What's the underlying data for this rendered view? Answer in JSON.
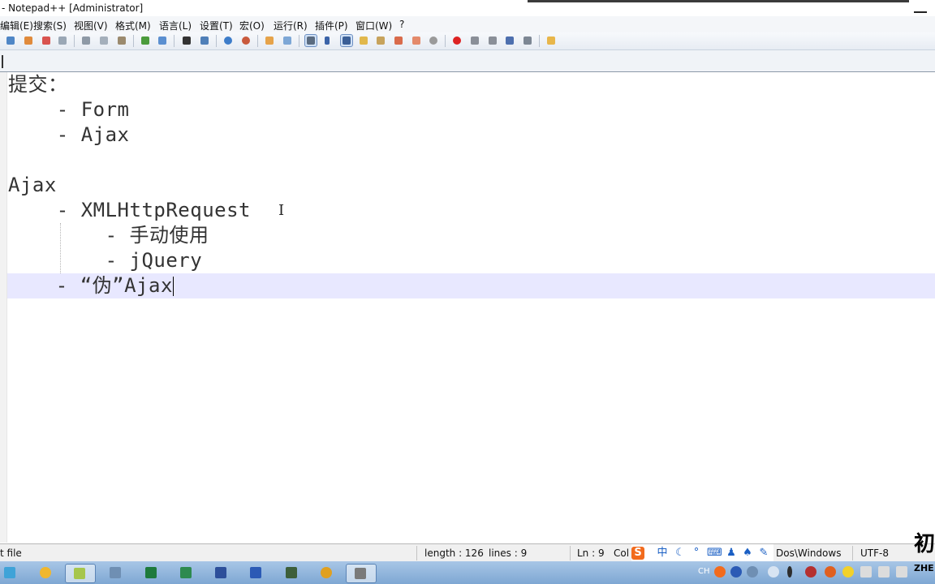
{
  "window": {
    "title": "- Notepad++ [Administrator]"
  },
  "menu": [
    {
      "label": "编辑(E)"
    },
    {
      "label": "搜索(S)"
    },
    {
      "label": "视图(V)"
    },
    {
      "label": "格式(M)"
    },
    {
      "label": "语言(L)"
    },
    {
      "label": "设置(T)"
    },
    {
      "label": "宏(O)"
    },
    {
      "label": "运行(R)"
    },
    {
      "label": "插件(P)"
    },
    {
      "label": "窗口(W)"
    },
    {
      "label": "?"
    }
  ],
  "toolbar_icons": [
    "new-file-icon",
    "open-file-icon",
    "save-icon",
    "save-all-icon",
    "close-icon",
    "print-icon",
    "cut-icon",
    "copy-icon",
    "paste-icon",
    "undo-icon",
    "redo-icon",
    "find-icon",
    "replace-icon",
    "zoom-in-icon",
    "zoom-out-icon",
    "sync-vertical-icon",
    "sync-horizontal-icon",
    "word-wrap-icon",
    "show-all-chars-icon",
    "indent-guide-icon",
    "user-defined-language-icon",
    "doc-map-icon",
    "function-list-icon",
    "folder-as-workspace-icon",
    "monitoring-icon",
    "record-macro-icon",
    "stop-macro-icon",
    "play-macro-icon",
    "run-macro-multiple-icon",
    "save-macro-icon",
    "launch-in-browser-icon"
  ],
  "editor": {
    "lines": [
      "提交：",
      "    - Form",
      "    - Ajax",
      "",
      "Ajax",
      "    - XMLHttpRequest",
      "        - 手动使用",
      "        - jQuery",
      "    - “伪”Ajax"
    ]
  },
  "status": {
    "file_type": "t file",
    "length": "length : 126",
    "lines": "lines : 9",
    "ln": "Ln : 9",
    "col": "Col :",
    "eol": "Dos\\Windows",
    "encoding": "UTF-8"
  },
  "ime": {
    "lang": "中"
  },
  "taskbar": {
    "tray_text": "CH",
    "logo_text": "初",
    "logo_sub": "ZHE"
  },
  "colors": {
    "current_line": "#e8e8ff",
    "taskbar": "#8fb4dc"
  }
}
